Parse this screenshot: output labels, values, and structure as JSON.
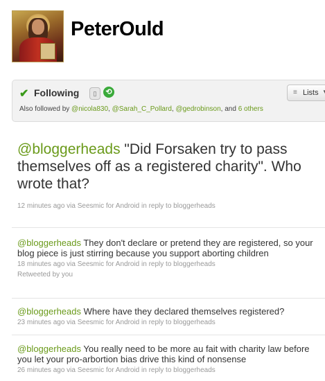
{
  "profile": {
    "screen_name": "PeterOuld"
  },
  "follow_box": {
    "status_label": "Following",
    "lists_label": "Lists",
    "also_followed_prefix": "Also followed by",
    "followers": [
      "@nicola830",
      "@Sarah_C_Pollard",
      "@gedrobinson"
    ],
    "and_text": ", and",
    "others_link": "6 others"
  },
  "main_tweet": {
    "mention": "@bloggerheads",
    "text": " \"Did Forsaken try to pass themselves off as a registered charity\". Who wrote that?",
    "time": "12 minutes ago",
    "via": "via",
    "client": "Seesmic for Android",
    "in_reply": "in reply to",
    "reply_to": "bloggerheads"
  },
  "tweets": [
    {
      "mention": "@bloggerheads",
      "text": " They don't declare or pretend they are registered, so your blog piece is just stirring because you support aborting children",
      "time": "18 minutes ago",
      "client": "Seesmic for Android",
      "reply_to": "bloggerheads",
      "retweeted": "Retweeted by you"
    },
    {
      "mention": "@bloggerheads",
      "text": " Where have they declared themselves registered?",
      "time": "23 minutes ago",
      "client": "Seesmic for Android",
      "reply_to": "bloggerheads"
    },
    {
      "mention": "@bloggerheads",
      "text": " You really need to be more au fait with charity law before you let your pro-arbortion bias drive this kind of nonsense",
      "time": "26 minutes ago",
      "client": "Seesmic for Android",
      "reply_to": "bloggerheads"
    }
  ],
  "colors": {
    "link_green": "#6a9a1a",
    "check_green": "#3a9a1a"
  },
  "icons": [
    "check-icon",
    "phone-icon",
    "retweet-icon",
    "list-icon",
    "caret-down-icon"
  ]
}
